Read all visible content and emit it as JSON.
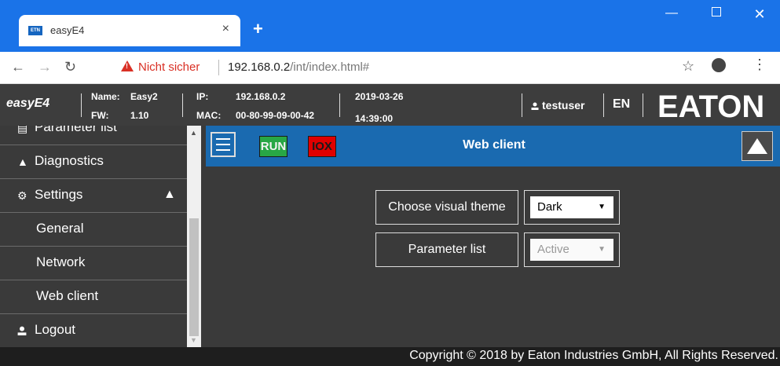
{
  "browser": {
    "tab_title": "easyE4",
    "tab_favicon": "ETN",
    "tab_close": "×",
    "new_tab": "+",
    "security_label": "Nicht sicher",
    "url_host": "192.168.0.2",
    "url_path": "/int/index.html#",
    "colors": {
      "titlebar": "#1a73e8"
    }
  },
  "header": {
    "brand": "easyE4",
    "name_label": "Name:",
    "name_value": "Easy2",
    "fw_label": "FW:",
    "fw_value": "1.10",
    "ip_label": "IP:",
    "ip_value": "192.168.0.2",
    "mac_label": "MAC:",
    "mac_value": "00-80-99-09-00-42",
    "date": "2019-03-26",
    "time": "14:39:00",
    "user": "testuser",
    "language": "EN",
    "logo_text": "EATON"
  },
  "sidebar": {
    "items": [
      {
        "label": "Parameter list",
        "icon": "list-icon"
      },
      {
        "label": "Diagnostics",
        "icon": "warning-icon"
      },
      {
        "label": "Settings",
        "icon": "gear-icon"
      },
      {
        "label": "General"
      },
      {
        "label": "Network"
      },
      {
        "label": "Web client"
      },
      {
        "label": "Logout",
        "icon": "user-icon"
      }
    ]
  },
  "main": {
    "run_label": "RUN",
    "iox_label": "IOX",
    "title": "Web client",
    "theme_label": "Choose visual theme",
    "theme_value": "Dark",
    "param_label": "Parameter list",
    "param_value": "Active",
    "colors": {
      "bar": "#1a6ab0",
      "run": "#28a745",
      "iox": "#e00000"
    }
  },
  "footer": {
    "copyright": "Copyright © 2018 by Eaton Industries GmbH, All Rights Reserved."
  }
}
